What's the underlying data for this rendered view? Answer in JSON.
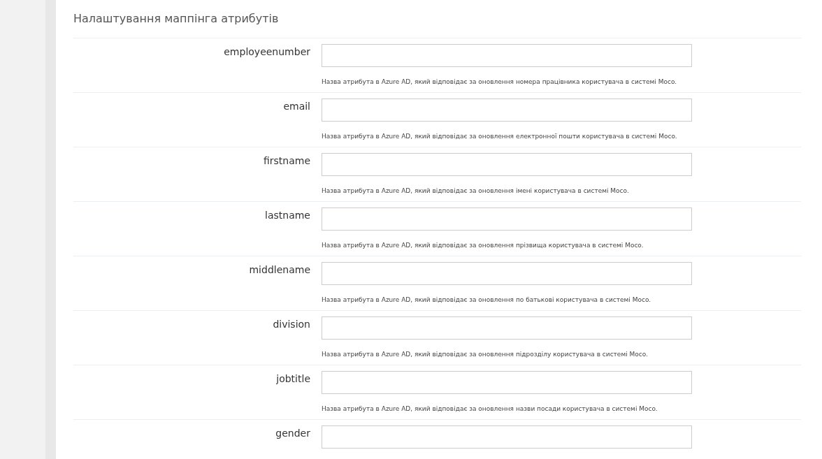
{
  "section": {
    "title": "Налаштування маппінга атрибутів"
  },
  "fields": [
    {
      "label": "employeenumber",
      "help": "Назва атрибута в Azure AD, який відповідає за оновлення номера працівника користувача в системі Moco."
    },
    {
      "label": "email",
      "help": "Назва атрибута в Azure AD, який відповідає за оновлення електронної пошти користувача в системі Moco."
    },
    {
      "label": "firstname",
      "help": "Назва атрибута в Azure AD, який відповідає за оновлення імені користувача в системі Moco."
    },
    {
      "label": "lastname",
      "help": "Назва атрибута в Azure AD, який відповідає за оновлення прізвища користувача в системі Moco."
    },
    {
      "label": "middlename",
      "help": "Назва атрибута в Azure AD, який відповідає за оновлення по батькові користувача в системі Moco."
    },
    {
      "label": "division",
      "help": "Назва атрибута в Azure AD, який відповідає за оновлення підрозділу користувача в системі Moco."
    },
    {
      "label": "jobtitle",
      "help": "Назва атрибута в Azure AD, який відповідає за оновлення назви посади користувача в системі Moco."
    },
    {
      "label": "gender"
    }
  ]
}
